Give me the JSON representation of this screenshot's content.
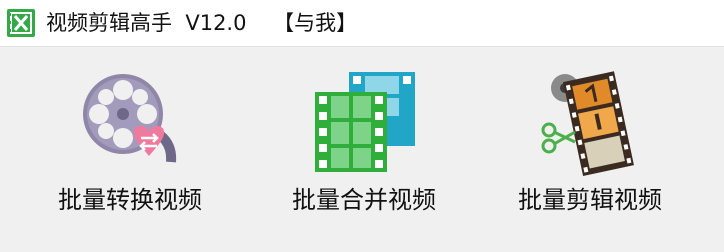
{
  "window": {
    "title": "视频剪辑高手  V12.0    【与我】",
    "app_icon": "film-strip-app-icon"
  },
  "tools": [
    {
      "label": "批量转换视频",
      "icon": "film-reel-convert-icon"
    },
    {
      "label": "批量合并视频",
      "icon": "merge-filmstrips-icon"
    },
    {
      "label": "批量剪辑视频",
      "icon": "filmstrip-scissors-icon"
    }
  ],
  "colors": {
    "titlebar_bg": "#ffffff",
    "window_bg": "#f0f0f0",
    "app_icon_green": "#35a84a",
    "reel_purple": "#8f86a8",
    "heart_pink": "#f07a9e",
    "merge_green": "#2fae3c",
    "merge_teal": "#22a6c8",
    "cut_film_dark": "#3b2a20",
    "cut_film_orange": "#e08a2a",
    "scissors_green": "#4cb04a"
  }
}
